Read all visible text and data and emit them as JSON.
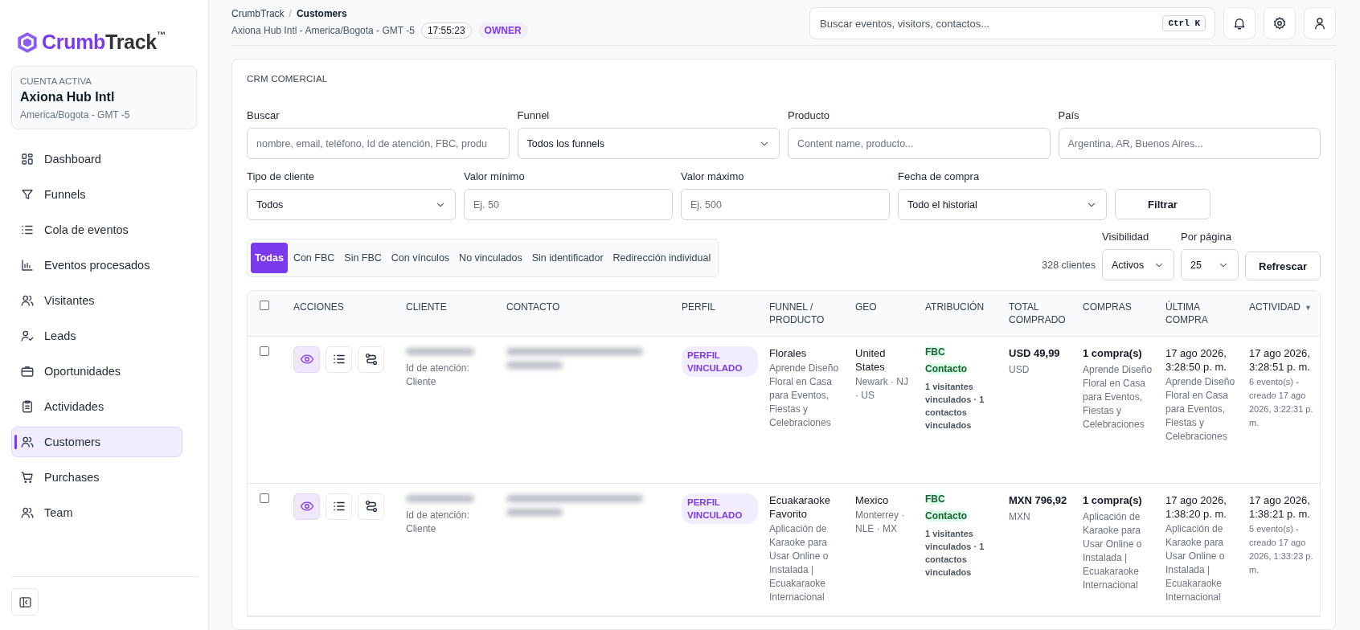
{
  "sidebar": {
    "brand_first": "Crumb",
    "brand_second": "Track",
    "brand_mark": "™",
    "account": {
      "label": "CUENTA ACTIVA",
      "name": "Axiona Hub Intl",
      "timezone": "America/Bogota - GMT -5"
    },
    "items": [
      {
        "label": "Dashboard",
        "kind": "grid",
        "selected": false
      },
      {
        "label": "Funnels",
        "kind": "filter",
        "selected": false
      },
      {
        "label": "Cola de eventos",
        "kind": "list",
        "selected": false
      },
      {
        "label": "Eventos procesados",
        "kind": "chart",
        "selected": false
      },
      {
        "label": "Visitantes",
        "kind": "users",
        "selected": false
      },
      {
        "label": "Leads",
        "kind": "usercheck",
        "selected": false
      },
      {
        "label": "Oportunidades",
        "kind": "briefcase",
        "selected": false
      },
      {
        "label": "Actividades",
        "kind": "clipboard",
        "selected": false
      },
      {
        "label": "Customers",
        "kind": "users",
        "selected": true
      },
      {
        "label": "Purchases",
        "kind": "cart",
        "selected": false
      },
      {
        "label": "Team",
        "kind": "users",
        "selected": false
      }
    ]
  },
  "header": {
    "breadcrumb": [
      "CrumbTrack",
      "Customers"
    ],
    "breadcrumb_separator": "/",
    "subtitle": "Axiona Hub Intl - America/Bogota - GMT -5",
    "time": "17:55:23",
    "role": "OWNER",
    "search": {
      "placeholder": "Buscar eventos, visitors, contactos...",
      "shortcut": "Ctrl K"
    },
    "actions": [
      {
        "kind": "bell"
      },
      {
        "kind": "gear"
      },
      {
        "kind": "user"
      }
    ]
  },
  "panel": {
    "title": "CRM COMERCIAL",
    "filters_row_1": [
      {
        "kind": "input",
        "label": "Buscar",
        "placeholder": "nombre, email, teléfono, Id de atención, FBC, produ"
      },
      {
        "kind": "select",
        "label": "Funnel",
        "value": "Todos los funnels"
      },
      {
        "kind": "input",
        "label": "Producto",
        "placeholder": "Content name, producto..."
      },
      {
        "kind": "input",
        "label": "País",
        "placeholder": "Argentina, AR, Buenos Aires..."
      }
    ],
    "filters_row_2": [
      {
        "kind": "select",
        "label": "Tipo de cliente",
        "value": "Todos"
      },
      {
        "kind": "input",
        "label": "Valor mínimo",
        "placeholder": "Ej. 50"
      },
      {
        "kind": "input",
        "label": "Valor máximo",
        "placeholder": "Ej. 500"
      },
      {
        "kind": "select",
        "label": "Fecha de compra",
        "value": "Todo el historial"
      }
    ],
    "filter_button": "Filtrar",
    "tabs": [
      {
        "label": "Todas",
        "selected": true
      },
      {
        "label": "Con FBC",
        "selected": false
      },
      {
        "label": "Sin FBC",
        "selected": false
      },
      {
        "label": "Con vínculos",
        "selected": false
      },
      {
        "label": "No vinculados",
        "selected": false
      },
      {
        "label": "Sin identificador",
        "selected": false
      },
      {
        "label": "Redirección individual",
        "selected": false
      }
    ],
    "count": "328 clientes",
    "visibility": {
      "label": "Visibilidad",
      "value": "Activos"
    },
    "per_page": {
      "label": "Por página",
      "value": "25"
    },
    "refresh_button": "Refrescar"
  },
  "table": {
    "select_all": {
      "checked": false
    },
    "columns": [
      {
        "label": "ACCIONES"
      },
      {
        "label": "CLIENTE"
      },
      {
        "label": "CONTACTO"
      },
      {
        "label": "PERFIL"
      },
      {
        "label": "FUNNEL / PRODUCTO"
      },
      {
        "label": "GEO"
      },
      {
        "label": "ATRIBUCIÓN"
      },
      {
        "label": "TOTAL COMPRADO"
      },
      {
        "label": "COMPRAS"
      },
      {
        "label": "ÚLTIMA COMPRA"
      },
      {
        "label": "ACTIVIDAD",
        "sort_icon": "▼"
      }
    ],
    "rows": [
      {
        "checked": false,
        "client_id_label": "Id de atención:",
        "client_type": "Cliente",
        "profile": "PERFIL VINCULADO",
        "funnel": "Florales",
        "product": "Aprende Diseño Floral en Casa para Eventos, Fiestas y Celebraciones",
        "country": "United States",
        "region": "Newark · NJ · US",
        "tags": [
          "FBC",
          "Contacto"
        ],
        "links": "1 visitantes vinculados · 1 contactos vinculados",
        "total": "USD 49,99",
        "currency": "USD",
        "purchases": "1 compra(s)",
        "purchase_product": "Aprende Diseño Floral en Casa para Eventos, Fiestas y Celebraciones",
        "last_purchase": "17 ago 2026, 3:28:50 p. m.",
        "last_product": "Aprende Diseño Floral en Casa para Eventos, Fiestas y Celebraciones",
        "activity": "17 ago 2026, 3:28:51 p. m.",
        "activity_detail": "6 evento(s) - creado 17 ago 2026, 3:22:31 p. m."
      },
      {
        "checked": false,
        "client_id_label": "Id de atención:",
        "client_type": "Cliente",
        "profile": "PERFIL VINCULADO",
        "funnel": "Ecuakaraoke Favorito",
        "product": "Aplicación de Karaoke para Usar Online o Instalada | Ecuakaraoke Internacional",
        "country": "Mexico",
        "region": "Monterrey · NLE · MX",
        "tags": [
          "FBC",
          "Contacto"
        ],
        "links": "1 visitantes vinculados · 1 contactos vinculados",
        "total": "MXN 796,92",
        "currency": "MXN",
        "purchases": "1 compra(s)",
        "purchase_product": "Aplicación de Karaoke para Usar Online o Instalada | Ecuakaraoke Internacional",
        "last_purchase": "17 ago 2026, 1:38:20 p. m.",
        "last_product": "Aplicación de Karaoke para Usar Online o Instalada | Ecuakaraoke Internacional",
        "activity": "17 ago 2026, 1:38:21 p. m.",
        "activity_detail": "5 evento(s) - creado 17 ago 2026, 1:33:23 p. m."
      }
    ]
  }
}
